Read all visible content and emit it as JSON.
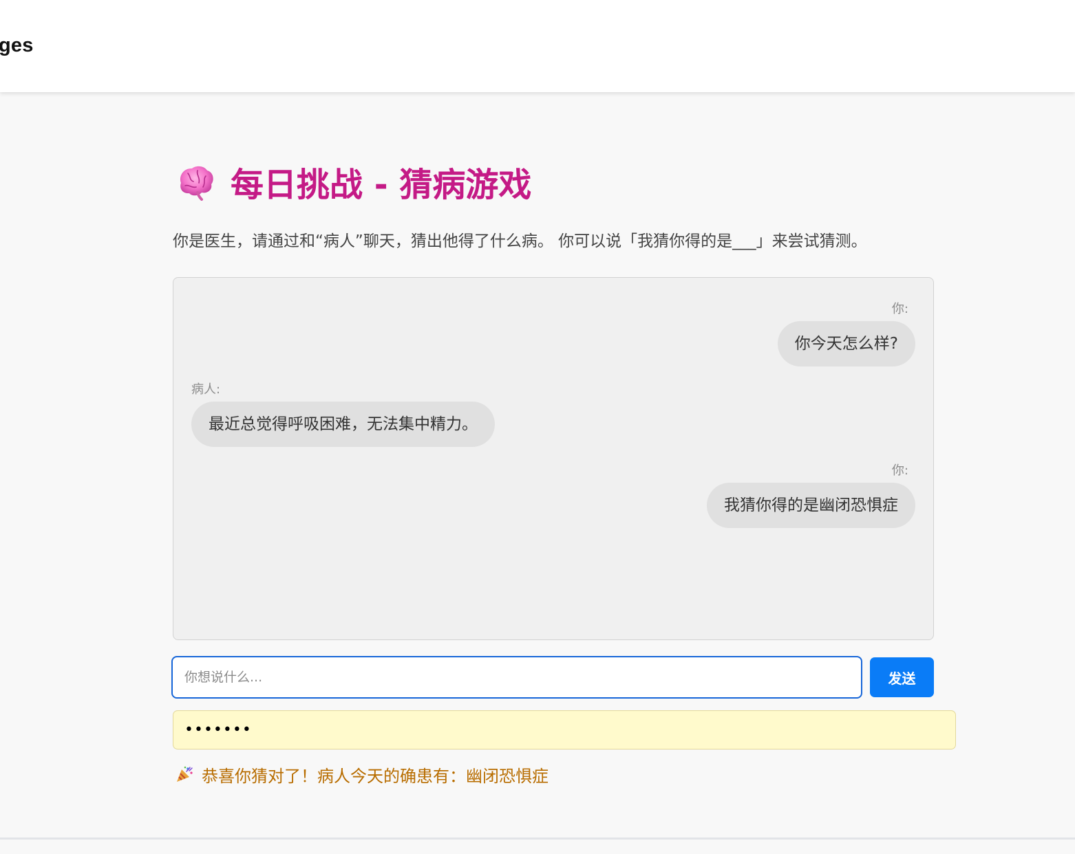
{
  "header": {
    "brand": "ges"
  },
  "game": {
    "title_icon": "brain-icon",
    "title": "每日挑战 - 猜病游戏",
    "intro": "你是医生，请通过和“病人”聊天，猜出他得了什么病。 你可以说「我猜你得的是___」来尝试猜测。"
  },
  "chat": {
    "messages": [
      {
        "sender": "你:",
        "text": "你今天怎么样?"
      },
      {
        "sender": "病人:",
        "text": "最近总觉得呼吸困难，无法集中精力。"
      },
      {
        "sender": "你:",
        "text": "我猜你得的是幽闭恐惧症"
      }
    ]
  },
  "composer": {
    "placeholder": "你想说什么...",
    "value": "",
    "send_label": "发送"
  },
  "secret": {
    "value": "1234567"
  },
  "result": {
    "icon": "party-popper-icon",
    "text": "恭喜你猜对了！病人今天的确患有：幽闭恐惧症"
  },
  "colors": {
    "title": "#c41a86",
    "send_button": "#0a7cf7",
    "input_focus_border": "#1565d8",
    "secret_bg": "#fffacc",
    "result_text": "#b86d00",
    "bubble_bg": "#e0e0e0",
    "chat_bg": "#f0f0f0"
  }
}
